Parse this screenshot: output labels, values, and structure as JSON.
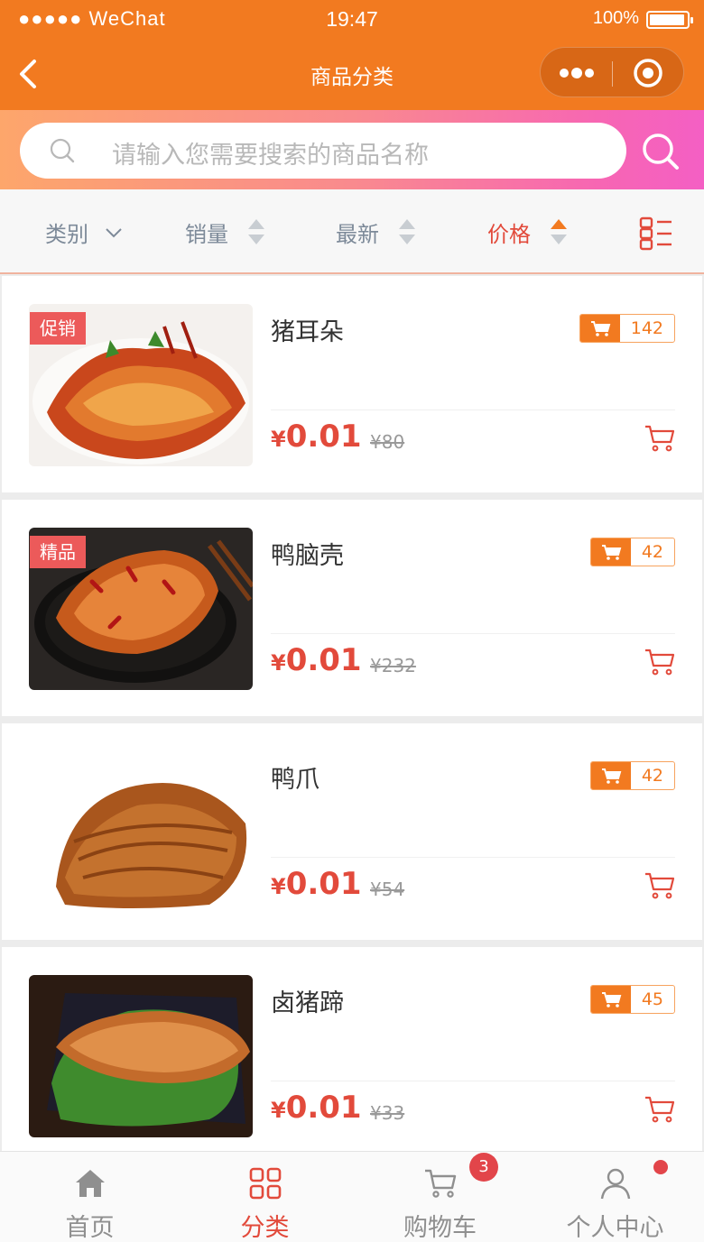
{
  "status_bar": {
    "signal": "●●●●● WeChat",
    "time": "19:47",
    "battery": "100%"
  },
  "nav": {
    "title": "商品分类"
  },
  "search": {
    "placeholder": "请输入您需要搜索的商品名称"
  },
  "filters": [
    {
      "label": "类别"
    },
    {
      "label": "销量"
    },
    {
      "label": "最新"
    },
    {
      "label": "价格",
      "active": true
    }
  ],
  "products": [
    {
      "name": "猪耳朵",
      "tag": "促销",
      "count": "142",
      "yen": "¥",
      "price": "0.01",
      "original_price": "¥80"
    },
    {
      "name": "鸭脑壳",
      "tag": "精品",
      "count": "42",
      "yen": "¥",
      "price": "0.01",
      "original_price": "¥232"
    },
    {
      "name": "鸭爪",
      "tag": "",
      "count": "42",
      "yen": "¥",
      "price": "0.01",
      "original_price": "¥54"
    },
    {
      "name": "卤猪蹄",
      "tag": "",
      "count": "45",
      "yen": "¥",
      "price": "0.01",
      "original_price": "¥33"
    }
  ],
  "tabbar": {
    "items": [
      {
        "label": "首页",
        "icon": "home-icon"
      },
      {
        "label": "分类",
        "icon": "category-icon",
        "active": true
      },
      {
        "label": "购物车",
        "icon": "cart-icon"
      },
      {
        "label": "个人中心",
        "icon": "user-icon"
      }
    ],
    "cart_badge": "3"
  },
  "colors": {
    "primary": "#f27a20",
    "accent_red": "#e24a3b",
    "tag_red": "#ec5a5a"
  }
}
